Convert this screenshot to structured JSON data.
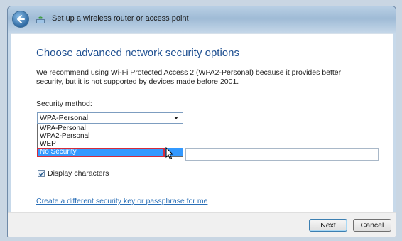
{
  "window": {
    "title": "Set up a wireless router or access point"
  },
  "content": {
    "heading": "Choose advanced network security options",
    "description": "We recommend using Wi-Fi Protected Access 2 (WPA2-Personal) because it provides better security,  but it is not supported by devices made before 2001.",
    "security_method_label": "Security method:",
    "security_method_value": "WPA-Personal",
    "security_method_options": [
      "WPA-Personal",
      "WPA2-Personal",
      "WEP",
      "No Security"
    ],
    "highlighted_option": "No Security",
    "display_characters_label": "Display characters",
    "display_characters_checked": true,
    "link_text": "Create a different security key or passphrase for me"
  },
  "footer": {
    "next_label": "Next",
    "cancel_label": "Cancel"
  },
  "icons": {
    "back": "back-arrow-icon",
    "wireless": "wireless-network-icon",
    "checkmark": "checkmark-icon",
    "cursor": "mouse-cursor-icon"
  }
}
